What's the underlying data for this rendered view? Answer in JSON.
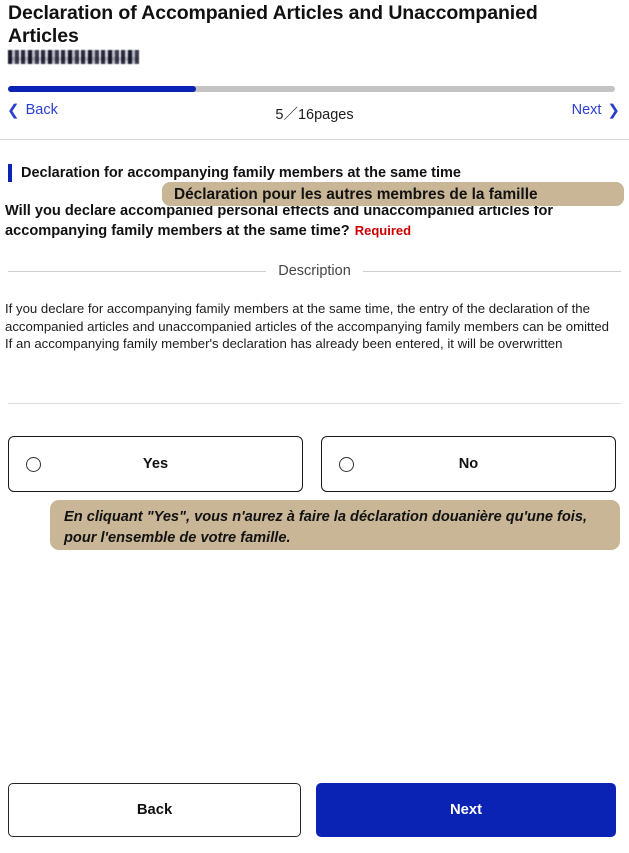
{
  "header": {
    "app_title": "Declaration of Accompanied Articles and Unaccompanied Articles",
    "redacted_label": "redacted-user-name",
    "progress_percent": 31,
    "nav": {
      "back_label": "Back",
      "back_chevron": "chevron-left-icon",
      "next_label": "Next",
      "next_chevron": "chevron-right-icon",
      "page_count": "5／16pages",
      "current_page": 5,
      "total_pages": 16
    }
  },
  "question_section": {
    "sub_heading": "Declaration for accompanying family members at the same time",
    "question_text": "Will you declare accompanied personal effects and unaccompanied articles for accompanying family members at the same time?",
    "required_label": "Required"
  },
  "french_overlays": {
    "heading_translation": "Déclaration pour les autres membres de la famille",
    "note": "En cliquant \"Yes\", vous n'aurez à faire la déclaration douanière qu'une fois, pour l'ensemble de votre famille."
  },
  "description": {
    "divider_label": "Description",
    "line1": "If you declare for accompanying family members at the same time, the entry of the declaration of the accompanied articles and unaccompanied articles of the accompanying family members can be omitted",
    "line2": "If an accompanying family member's declaration has already been entered, it will be overwritten"
  },
  "options": [
    {
      "id": "yes",
      "label": "Yes",
      "selected": false
    },
    {
      "id": "no",
      "label": "No",
      "selected": false
    }
  ],
  "footer": {
    "back_label": "Back",
    "next_label": "Next"
  },
  "colors": {
    "accent_blue": "#0b23b5",
    "link_blue": "#2b3fcf",
    "required_red": "#cc0000",
    "overlay_tan": "#c8b696",
    "track_gray": "#c4c4c4"
  }
}
